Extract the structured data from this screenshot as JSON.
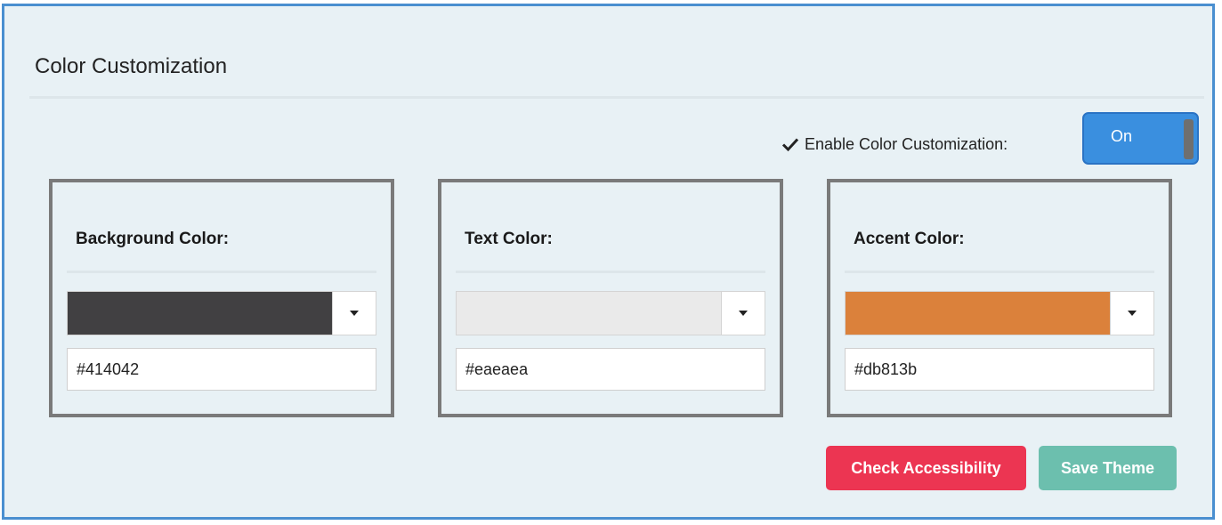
{
  "panel": {
    "title": "Color Customization"
  },
  "enable": {
    "label": "Enable Color Customization:",
    "toggle_label": "On",
    "enabled": true
  },
  "cards": [
    {
      "title": "Background Color:",
      "value": "#414042",
      "swatch_color": "#414042"
    },
    {
      "title": "Text Color:",
      "value": "#eaeaea",
      "swatch_color": "#eaeaea"
    },
    {
      "title": "Accent Color:",
      "value": "#db813b",
      "swatch_color": "#db813b"
    }
  ],
  "buttons": {
    "check_accessibility": "Check Accessibility",
    "save_theme": "Save Theme"
  },
  "icons": {
    "enable_check": "check-icon",
    "dropdown": "caret-down-icon"
  },
  "colors": {
    "panel_border": "#4a8fd0",
    "panel_background": "#e8f1f5",
    "toggle_on": "#3a8fdf",
    "check_button": "#ec3552",
    "save_button": "#6cbfae"
  }
}
